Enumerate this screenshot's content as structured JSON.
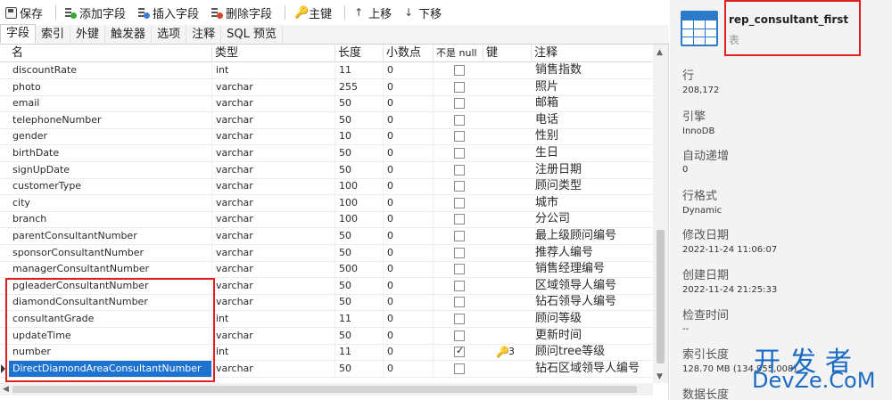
{
  "toolbar": {
    "save": "保存",
    "add_field": "添加字段",
    "insert_field": "插入字段",
    "delete_field": "删除字段",
    "primary_key": "主键",
    "move_up": "上移",
    "move_down": "下移"
  },
  "tabs": [
    "字段",
    "索引",
    "外键",
    "触发器",
    "选项",
    "注释",
    "SQL 预览"
  ],
  "columns": {
    "name": "名",
    "type": "类型",
    "length": "长度",
    "decimals": "小数点",
    "not_null": "不是 null",
    "key": "键",
    "comment": "注释"
  },
  "rows": [
    {
      "name": "discountRate",
      "type": "int",
      "length": "11",
      "decimals": "0",
      "not_null": false,
      "key": "",
      "comment": "销售指数"
    },
    {
      "name": "photo",
      "type": "varchar",
      "length": "255",
      "decimals": "0",
      "not_null": false,
      "key": "",
      "comment": "照片"
    },
    {
      "name": "email",
      "type": "varchar",
      "length": "50",
      "decimals": "0",
      "not_null": false,
      "key": "",
      "comment": "邮箱"
    },
    {
      "name": "telephoneNumber",
      "type": "varchar",
      "length": "50",
      "decimals": "0",
      "not_null": false,
      "key": "",
      "comment": "电话"
    },
    {
      "name": "gender",
      "type": "varchar",
      "length": "10",
      "decimals": "0",
      "not_null": false,
      "key": "",
      "comment": "性别"
    },
    {
      "name": "birthDate",
      "type": "varchar",
      "length": "50",
      "decimals": "0",
      "not_null": false,
      "key": "",
      "comment": "生日"
    },
    {
      "name": "signUpDate",
      "type": "varchar",
      "length": "50",
      "decimals": "0",
      "not_null": false,
      "key": "",
      "comment": "注册日期"
    },
    {
      "name": "customerType",
      "type": "varchar",
      "length": "100",
      "decimals": "0",
      "not_null": false,
      "key": "",
      "comment": "顾问类型"
    },
    {
      "name": "city",
      "type": "varchar",
      "length": "100",
      "decimals": "0",
      "not_null": false,
      "key": "",
      "comment": "城市"
    },
    {
      "name": "branch",
      "type": "varchar",
      "length": "100",
      "decimals": "0",
      "not_null": false,
      "key": "",
      "comment": "分公司"
    },
    {
      "name": "parentConsultantNumber",
      "type": "varchar",
      "length": "50",
      "decimals": "0",
      "not_null": false,
      "key": "",
      "comment": "最上级顾问编号"
    },
    {
      "name": "sponsorConsultantNumber",
      "type": "varchar",
      "length": "50",
      "decimals": "0",
      "not_null": false,
      "key": "",
      "comment": "推荐人编号"
    },
    {
      "name": "managerConsultantNumber",
      "type": "varchar",
      "length": "500",
      "decimals": "0",
      "not_null": false,
      "key": "",
      "comment": "销售经理编号"
    },
    {
      "name": "pgleaderConsultantNumber",
      "type": "varchar",
      "length": "50",
      "decimals": "0",
      "not_null": false,
      "key": "",
      "comment": "区域领导人编号"
    },
    {
      "name": "diamondConsultantNumber",
      "type": "varchar",
      "length": "50",
      "decimals": "0",
      "not_null": false,
      "key": "",
      "comment": "钻石领导人编号"
    },
    {
      "name": "consultantGrade",
      "type": "int",
      "length": "11",
      "decimals": "0",
      "not_null": false,
      "key": "",
      "comment": "顾问等级"
    },
    {
      "name": "updateTime",
      "type": "varchar",
      "length": "50",
      "decimals": "0",
      "not_null": false,
      "key": "",
      "comment": "更新时间"
    },
    {
      "name": "number",
      "type": "int",
      "length": "11",
      "decimals": "0",
      "not_null": true,
      "key": "3",
      "comment": "顾问tree等级"
    },
    {
      "name": "DirectDiamondAreaConsultantNumber",
      "type": "varchar",
      "length": "50",
      "decimals": "0",
      "not_null": false,
      "key": "",
      "comment": "钻石区域领导人编号"
    }
  ],
  "selected_row": "DirectDiamondAreaConsultantNumber",
  "info": {
    "table_name": "rep_consultant_first",
    "table_kind": "表",
    "rows_label": "行",
    "rows_value": "208,172",
    "engine_label": "引擎",
    "engine_value": "InnoDB",
    "auto_increment_label": "自动递增",
    "auto_increment_value": "0",
    "row_format_label": "行格式",
    "row_format_value": "Dynamic",
    "modified_label": "修改日期",
    "modified_value": "2022-11-24 11:06:07",
    "created_label": "创建日期",
    "created_value": "2022-11-24 21:25:33",
    "check_time_label": "检查时间",
    "check_time_value": "--",
    "index_length_label": "索引长度",
    "index_length_value": "128.70 MB (134,955,008)",
    "data_length_label": "数据长度"
  },
  "watermark": {
    "line1": "开发者",
    "line2": "DevZe.CoM"
  },
  "colors": {
    "selection": "#1e73d0",
    "highlight_box": "#e02020",
    "table_icon": "#2b7bc9",
    "watermark": "#1c6cc4"
  }
}
